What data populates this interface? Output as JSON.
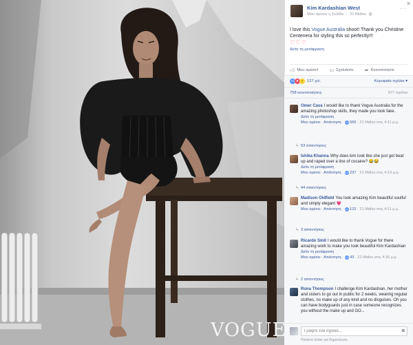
{
  "post": {
    "author": "Kim Kardashian West",
    "liked_page": "Μου αρέσει η Σελίδα",
    "date": "21 Μαΐου",
    "text_before": "I love this ",
    "text_link": "Vogue Australia",
    "text_after": " shoot! Thank you Christine Centenera for styling this so perfectly!!!",
    "hearts": "♡♡♡",
    "see_translation": "Δείτε τη μετάφραση"
  },
  "photo": {
    "watermark": "VOGUE"
  },
  "actions": {
    "like": "Μου αρέσει!",
    "comment": "Σχολιάστε",
    "share": "Κοινοποιήστε"
  },
  "reactions": {
    "count": "127 χιλ.",
    "sort": "Κορυφαία σχόλια ▾"
  },
  "counts": {
    "shares": "758 κοινοποιήσεις",
    "comments": "977 σχόλια"
  },
  "comments": [
    {
      "name": "Omer Cava",
      "text": "I would like to thank Vogue Australia for the amazing photoshop skills, they made you look fake.",
      "see_translation": "Δείτε τη μετάφραση",
      "like": "Μου αρέσει",
      "reply": "Απάντηση",
      "likes": "565",
      "time": "21 Μαΐου στις 4:11 μ.μ.",
      "replies": "53 απαντήσεις"
    },
    {
      "name": "Ishika Khanna",
      "text": "Why does kim look like she just got beat up and raped over a line of cocaine? 😂😂",
      "see_translation": "Δείτε τη μετάφραση",
      "like": "Μου αρέσει",
      "reply": "Απάντηση",
      "likes": "237",
      "time": "21 Μαΐου στις 4:13 μ.μ.",
      "replies": "44 απαντήσεις"
    },
    {
      "name": "Madison Oldfield",
      "text": "You look amazing Kim beautiful soulful and simply elegant 💗",
      "see_translation": "",
      "like": "Μου αρέσει",
      "reply": "Απάντηση",
      "likes": "122",
      "time": "21 Μαΐου στις 4:11 μ.μ.",
      "replies": "3 απαντήσεις"
    },
    {
      "name": "Ricardo Smit",
      "text": "I would like to thank Vogue for there amazing work to make you look beautiful Kim Kardashian",
      "see_translation": "Δείτε τη μετάφραση",
      "like": "Μου αρέσει",
      "reply": "Απάντηση",
      "likes": "43",
      "time": "21 Μαΐου στις 4:16 μ.μ.",
      "replies": "2 απαντήσεις"
    },
    {
      "name": "Rona Thompson",
      "text": "I challenge Kim Kardashian, her mother and sisters to go out in public for 2 weeks, wearing regular clothes, no make up of any kind and no disguises. Oh you can have bodyguards just in case someone recognizes you without the make up and GO...",
      "see_translation": "",
      "like": "",
      "reply": "",
      "likes": "",
      "time": "",
      "replies": ""
    }
  ],
  "write": {
    "placeholder": "Γράψτε ένα σχόλιο...",
    "hint": "Πατήστε Enter για δημοσίευση."
  },
  "colors": {
    "link": "#365899",
    "heart": "#f25268",
    "panel_bg": "#f6f7f9"
  }
}
